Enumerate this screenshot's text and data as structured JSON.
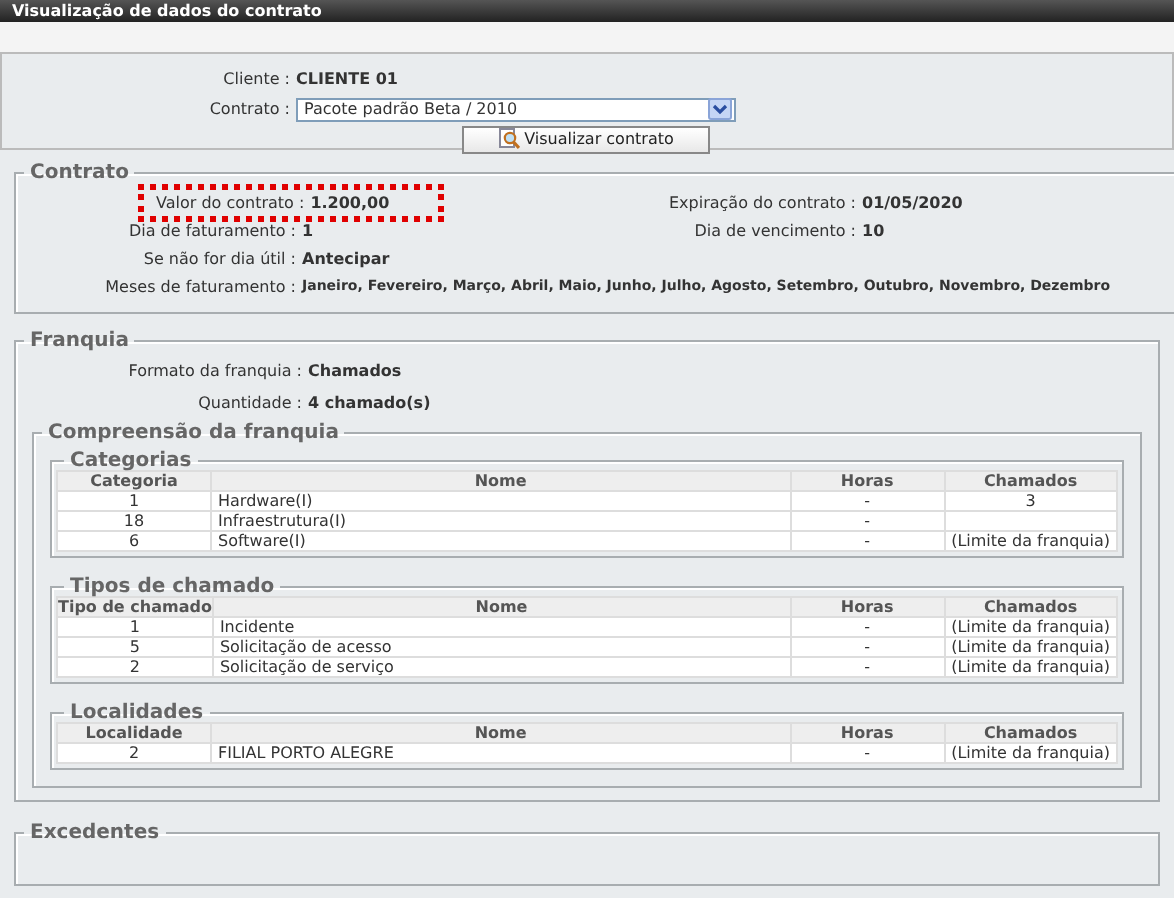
{
  "window": {
    "title": "Visualização de dados do contrato"
  },
  "client": {
    "label": "Cliente :",
    "value": "CLIENTE 01"
  },
  "contract_select": {
    "label": "Contrato :",
    "value": "Pacote padrão Beta / 2010"
  },
  "view_button": {
    "label": "Visualizar contrato"
  },
  "contrato": {
    "legend": "Contrato",
    "rows": [
      [
        {
          "label": "Valor do contrato :",
          "value": "1.200,00",
          "highlighted": true
        },
        {
          "label": "Expiração do contrato :",
          "value": "01/05/2020",
          "highlighted": false
        }
      ],
      [
        {
          "label": "Dia de faturamento :",
          "value": "1",
          "highlighted": false
        },
        {
          "label": "Dia de vencimento :",
          "value": "10",
          "highlighted": false
        }
      ],
      [
        {
          "label": "Se não for dia útil :",
          "value": "Antecipar",
          "highlighted": false
        }
      ],
      [
        {
          "label": "Meses de faturamento :",
          "value": "Janeiro, Fevereiro, Março, Abril, Maio, Junho, Julho, Agosto, Setembro, Outubro, Novembro, Dezembro",
          "highlighted": false
        }
      ]
    ]
  },
  "franquia": {
    "legend": "Franquia",
    "fields": [
      {
        "label": "Formato da franquia :",
        "value": "Chamados"
      },
      {
        "label": "Quantidade :",
        "value": "4 chamado(s)"
      }
    ],
    "compreensao": {
      "legend": "Compreensão da franquia",
      "tables": [
        {
          "legend": "Categorias",
          "columns": [
            "Categoria",
            "Nome",
            "Horas",
            "Chamados"
          ],
          "rows": [
            [
              "1",
              "Hardware(I)",
              "-",
              "3"
            ],
            [
              "18",
              "Infraestrutura(I)",
              "-",
              ""
            ],
            [
              "6",
              "Software(I)",
              "-",
              "(Limite da franquia)"
            ]
          ]
        },
        {
          "legend": "Tipos de chamado",
          "columns": [
            "Tipo de chamado",
            "Nome",
            "Horas",
            "Chamados"
          ],
          "rows": [
            [
              "1",
              "Incidente",
              "-",
              "(Limite da franquia)"
            ],
            [
              "5",
              "Solicitação de acesso",
              "-",
              "(Limite da franquia)"
            ],
            [
              "2",
              "Solicitação de serviço",
              "-",
              "(Limite da franquia)"
            ]
          ]
        },
        {
          "legend": "Localidades",
          "columns": [
            "Localidade",
            "Nome",
            "Horas",
            "Chamados"
          ],
          "rows": [
            [
              "2",
              "FILIAL PORTO ALEGRE",
              "-",
              "(Limite da franquia)"
            ]
          ]
        }
      ]
    }
  },
  "excedentes": {
    "legend": "Excedentes"
  }
}
